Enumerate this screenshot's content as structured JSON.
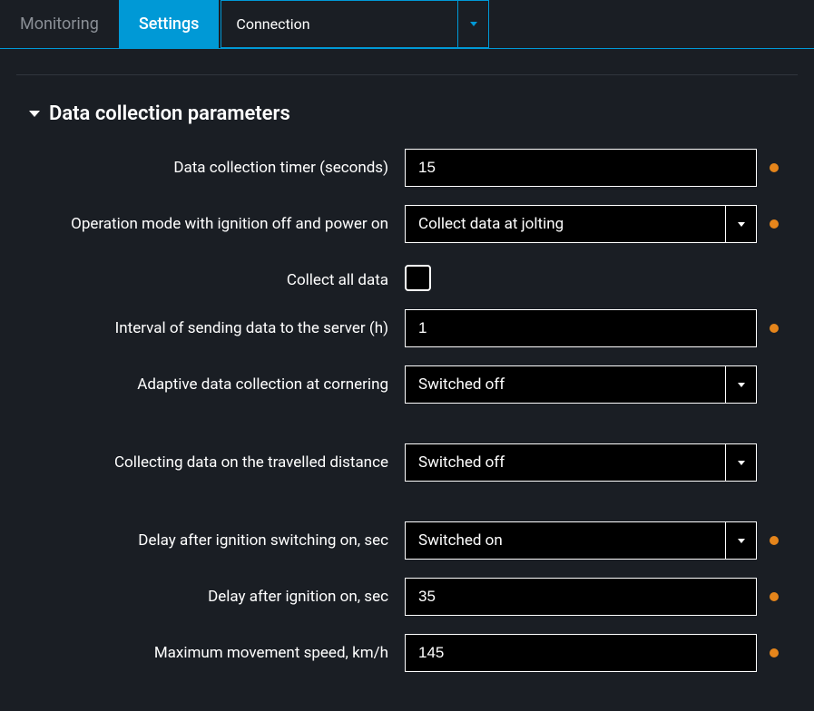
{
  "tabs": {
    "monitoring": "Monitoring",
    "settings": "Settings"
  },
  "connection": {
    "label": "Connection"
  },
  "section": {
    "title": "Data collection parameters"
  },
  "fields": {
    "timer": {
      "label": "Data collection timer (seconds)",
      "value": "15"
    },
    "opmode": {
      "label": "Operation mode with ignition off and power on",
      "value": "Collect data at jolting"
    },
    "collectall": {
      "label": "Collect all data"
    },
    "interval": {
      "label": "Interval of sending data to the server (h)",
      "value": "1"
    },
    "adaptive": {
      "label": "Adaptive data collection at cornering",
      "value": "Switched off"
    },
    "distance": {
      "label": "Collecting data on the travelled distance",
      "value": "Switched off"
    },
    "delayswitch": {
      "label": "Delay after ignition switching on, sec",
      "value": "Switched on"
    },
    "delayon": {
      "label": "Delay after ignition on, sec",
      "value": "35"
    },
    "maxspeed": {
      "label": "Maximum movement speed, km/h",
      "value": "145"
    }
  }
}
